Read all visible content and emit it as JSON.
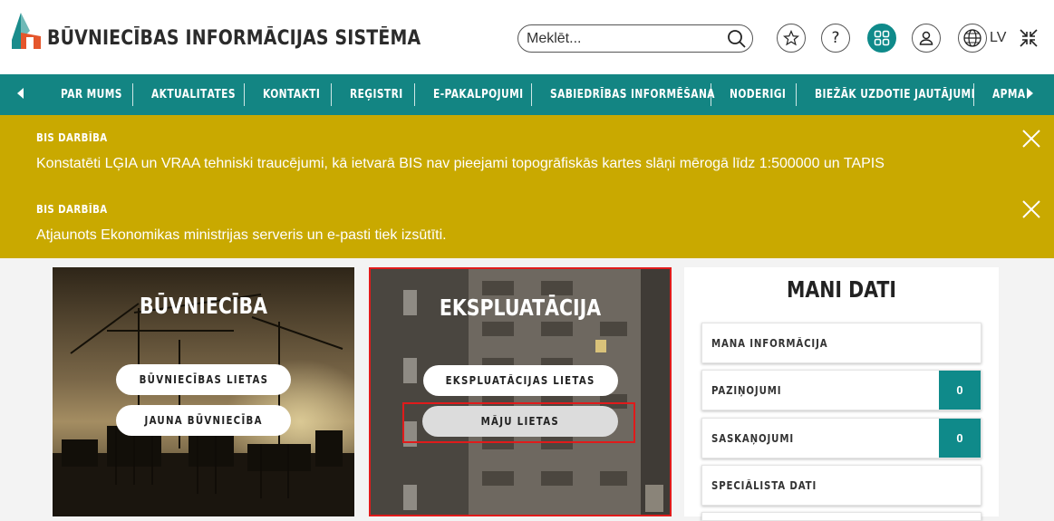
{
  "header": {
    "title": "BŪVNIECĪBAS INFORMĀCIJAS SISTĒMA",
    "search_placeholder": "Meklēt...",
    "language": "LV",
    "icons": [
      "star-icon",
      "help-icon",
      "apps-grid-icon",
      "user-icon",
      "globe-icon",
      "collapse-icon"
    ],
    "accent_color": "#0f8a8a"
  },
  "nav": {
    "items": [
      "PAR MUMS",
      "AKTUALITĀTES",
      "KONTAKTI",
      "REĢISTRI",
      "E-PAKALPOJUMI",
      "SABIEDRĪBAS INFORMĒŠANA",
      "NODERĪGI",
      "BIEŽĀK UZDOTIE JAUTĀJUMI",
      "APMĀ"
    ],
    "background_color": "#138583"
  },
  "notices": {
    "background_color": "#c9a900",
    "items": [
      {
        "heading": "BIS DARBĪBA",
        "text": "Konstatēti LĢIA un VRAA tehniski traucējumi, kā ietvarā BIS nav pieejami topogrāfiskās kartes slāņi mērogā līdz 1:500000 un TAPIS"
      },
      {
        "heading": "BIS DARBĪBA",
        "text": "Atjaunots Ekonomikas ministrijas serveris un e-pasti tiek izsūtīti."
      }
    ]
  },
  "cards": {
    "buvnieciba": {
      "title": "BŪVNIECĪBA",
      "buttons": [
        "BŪVNIECĪBAS LIETAS",
        "JAUNA BŪVNIECĪBA"
      ]
    },
    "ekspluatacija": {
      "title": "EKSPLUATĀCIJA",
      "buttons": [
        "EKSPLUATĀCIJAS LIETAS",
        "MĀJU LIETAS"
      ]
    }
  },
  "mani_dati": {
    "title": "MANI DATI",
    "rows": [
      {
        "label": "MANA INFORMĀCIJA"
      },
      {
        "label": "PAZIŅOJUMI",
        "count": "0"
      },
      {
        "label": "SASKAŅOJUMI",
        "count": "0"
      },
      {
        "label": "SPECIĀLISTA DATI"
      }
    ]
  },
  "highlight_color": "#e01b1b"
}
